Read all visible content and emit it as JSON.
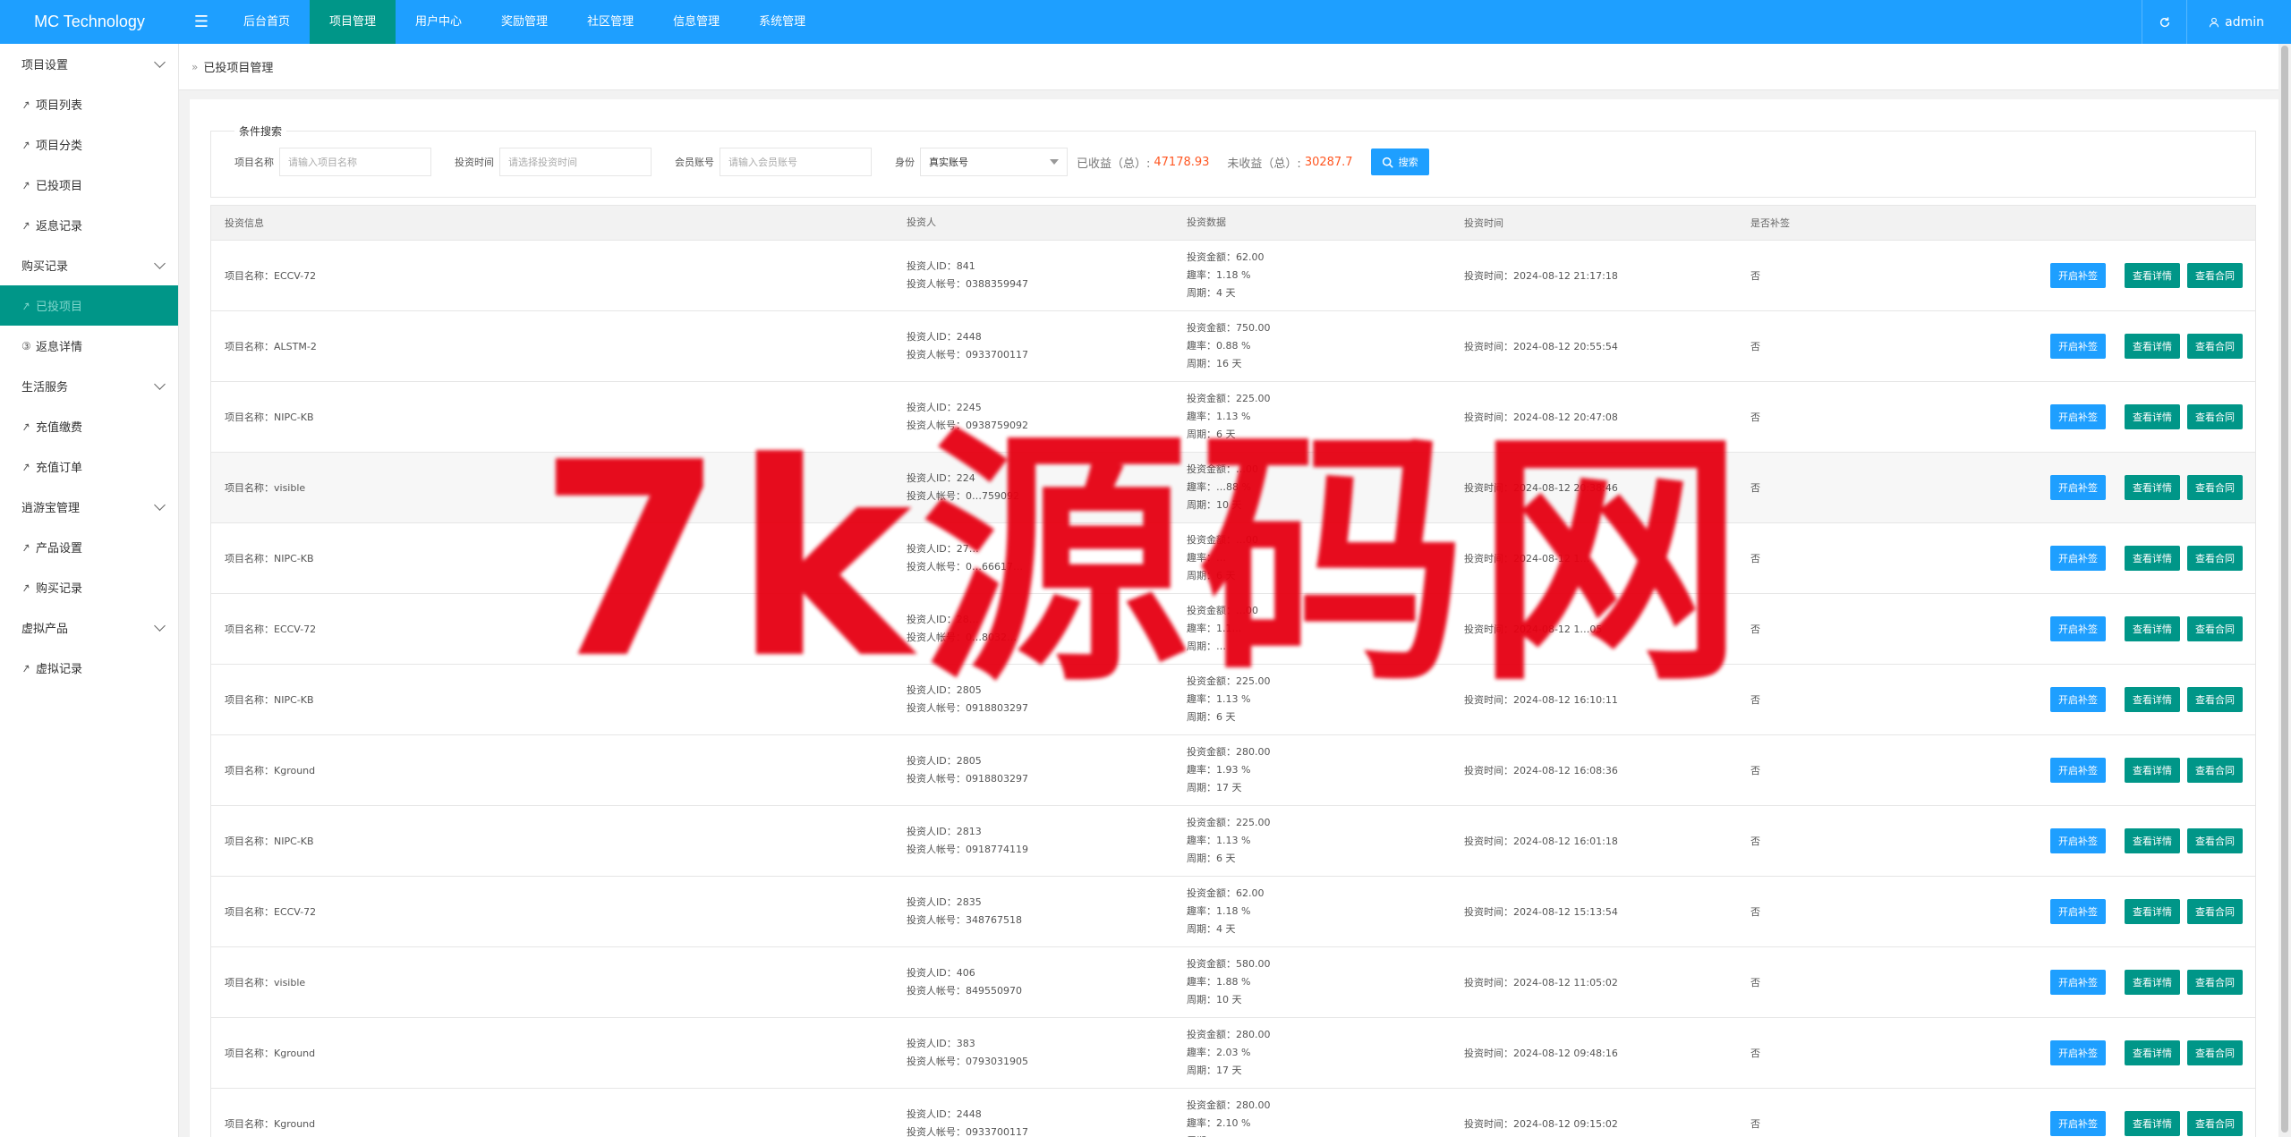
{
  "app": {
    "logo": "MC Technology",
    "menu_toggle": "☰"
  },
  "topnav": [
    {
      "label": "后台首页",
      "active": false
    },
    {
      "label": "项目管理",
      "active": true
    },
    {
      "label": "用户中心",
      "active": false
    },
    {
      "label": "奖励管理",
      "active": false
    },
    {
      "label": "社区管理",
      "active": false
    },
    {
      "label": "信息管理",
      "active": false
    },
    {
      "label": "系统管理",
      "active": false
    }
  ],
  "user": {
    "name": "admin"
  },
  "sidebar": [
    {
      "type": "group",
      "label": "项目设置"
    },
    {
      "type": "item",
      "label": "项目列表",
      "icon": "link-icon"
    },
    {
      "type": "item",
      "label": "项目分类",
      "icon": "link-icon"
    },
    {
      "type": "item",
      "label": "已投项目",
      "icon": "link-icon"
    },
    {
      "type": "item",
      "label": "返息记录",
      "icon": "link-icon"
    },
    {
      "type": "group",
      "label": "购买记录"
    },
    {
      "type": "item",
      "label": "已投项目",
      "icon": "link-icon",
      "active": true
    },
    {
      "type": "item",
      "label": "返息详情",
      "icon": "coin-icon"
    },
    {
      "type": "group",
      "label": "生活服务"
    },
    {
      "type": "item",
      "label": "充值缴费",
      "icon": "link-icon"
    },
    {
      "type": "item",
      "label": "充值订单",
      "icon": "link-icon"
    },
    {
      "type": "group",
      "label": "逍游宝管理"
    },
    {
      "type": "item",
      "label": "产品设置",
      "icon": "link-icon"
    },
    {
      "type": "item",
      "label": "购买记录",
      "icon": "link-icon"
    },
    {
      "type": "group",
      "label": "虚拟产品"
    },
    {
      "type": "item",
      "label": "虚拟记录",
      "icon": "link-icon"
    }
  ],
  "breadcrumb": {
    "sep": "»",
    "current": "已投项目管理"
  },
  "search": {
    "legend": "条件搜索",
    "project_label": "项目名称",
    "project_placeholder": "请输入项目名称",
    "time_label": "投资时间",
    "time_placeholder": "请选择投资时间",
    "account_label": "会员账号",
    "account_placeholder": "请输入会员账号",
    "identity_label": "身份",
    "identity_value": "真实账号",
    "earned_label": "已收益（总）:",
    "earned_value": "47178.93",
    "unearned_label": "未收益（总）:",
    "unearned_value": "30287.7",
    "button": "搜索"
  },
  "table": {
    "headers": [
      "投资信息",
      "投资人",
      "投资数据",
      "投资时间",
      "是否补签"
    ],
    "actions": {
      "resign": "开启补签",
      "detail": "查看详情",
      "contract": "查看合同"
    },
    "rows": [
      {
        "project": "项目名称：ECCV-72",
        "investor_id": "投资人ID：841",
        "investor_acct": "投资人帐号：0388359947",
        "amount": "投资金额：62.00",
        "rate": "趣率：1.18 %",
        "period": "周期：4 天",
        "time": "投资时间：2024-08-12 21:17:18",
        "resign": "否"
      },
      {
        "project": "项目名称：ALSTM-2",
        "investor_id": "投资人ID：2448",
        "investor_acct": "投资人帐号：0933700117",
        "amount": "投资金额：750.00",
        "rate": "趣率：0.88 %",
        "period": "周期：16 天",
        "time": "投资时间：2024-08-12 20:55:54",
        "resign": "否"
      },
      {
        "project": "项目名称：NIPC-KB",
        "investor_id": "投资人ID：2245",
        "investor_acct": "投资人帐号：0938759092",
        "amount": "投资金额：225.00",
        "rate": "趣率：1.13 %",
        "period": "周期：6 天",
        "time": "投资时间：2024-08-12 20:47:08",
        "resign": "否"
      },
      {
        "project": "项目名称：visible",
        "investor_id": "投资人ID：224",
        "investor_acct": "投资人帐号：0…759092",
        "amount": "投资金额：…00",
        "rate": "趣率：…88 %",
        "period": "周期：10 天",
        "time": "投资时间：2024-08-12 20:38:46",
        "resign": "否",
        "hl": true
      },
      {
        "project": "项目名称：NIPC-KB",
        "investor_id": "投资人ID：27…",
        "investor_acct": "投资人帐号：0…66617…",
        "amount": "投资金额：…00",
        "rate": "趣率：…",
        "period": "周期：6 天",
        "time": "投资时间：2024-08-12 1…",
        "resign": "否"
      },
      {
        "project": "项目名称：ECCV-72",
        "investor_id": "投资人ID：28…",
        "investor_acct": "投资人帐号：0…8032…",
        "amount": "投资金额：…00",
        "rate": "趣率：1.1…",
        "period": "周期：…",
        "time": "投资时间：2024-08-12 1…05",
        "resign": "否"
      },
      {
        "project": "项目名称：NIPC-KB",
        "investor_id": "投资人ID：2805",
        "investor_acct": "投资人帐号：0918803297",
        "amount": "投资金额：225.00",
        "rate": "趣率：1.13 %",
        "period": "周期：6 天",
        "time": "投资时间：2024-08-12 16:10:11",
        "resign": "否"
      },
      {
        "project": "项目名称：Kground",
        "investor_id": "投资人ID：2805",
        "investor_acct": "投资人帐号：0918803297",
        "amount": "投资金额：280.00",
        "rate": "趣率：1.93 %",
        "period": "周期：17 天",
        "time": "投资时间：2024-08-12 16:08:36",
        "resign": "否"
      },
      {
        "project": "项目名称：NIPC-KB",
        "investor_id": "投资人ID：2813",
        "investor_acct": "投资人帐号：0918774119",
        "amount": "投资金额：225.00",
        "rate": "趣率：1.13 %",
        "period": "周期：6 天",
        "time": "投资时间：2024-08-12 16:01:18",
        "resign": "否"
      },
      {
        "project": "项目名称：ECCV-72",
        "investor_id": "投资人ID：2835",
        "investor_acct": "投资人帐号：348767518",
        "amount": "投资金额：62.00",
        "rate": "趣率：1.18 %",
        "period": "周期：4 天",
        "time": "投资时间：2024-08-12 15:13:54",
        "resign": "否"
      },
      {
        "project": "项目名称：visible",
        "investor_id": "投资人ID：406",
        "investor_acct": "投资人帐号：849550970",
        "amount": "投资金额：580.00",
        "rate": "趣率：1.88 %",
        "period": "周期：10 天",
        "time": "投资时间：2024-08-12 11:05:02",
        "resign": "否"
      },
      {
        "project": "项目名称：Kground",
        "investor_id": "投资人ID：383",
        "investor_acct": "投资人帐号：0793031905",
        "amount": "投资金额：280.00",
        "rate": "趣率：2.03 %",
        "period": "周期：17 天",
        "time": "投资时间：2024-08-12 09:48:16",
        "resign": "否"
      },
      {
        "project": "项目名称：Kground",
        "investor_id": "投资人ID：2448",
        "investor_acct": "投资人帐号：0933700117",
        "amount": "投资金额：280.00",
        "rate": "趣率：2.10 %",
        "period": "周期：…",
        "time": "投资时间：2024-08-12 09:15:02",
        "resign": "否"
      }
    ]
  },
  "watermark": "7k源码网",
  "colors": {
    "primary": "#1e9fff",
    "accent": "#009688",
    "highlight": "#ff5722"
  }
}
